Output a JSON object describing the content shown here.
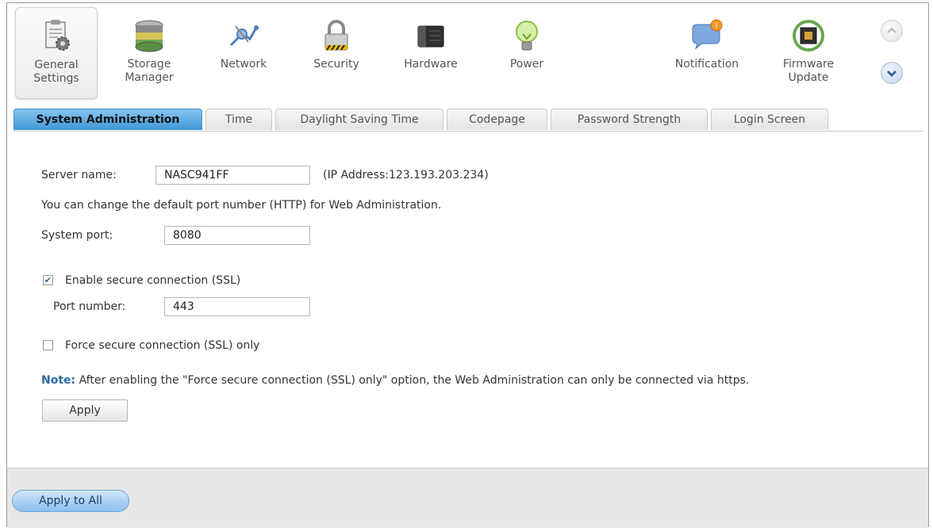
{
  "toolbar": {
    "items": [
      {
        "label": "General\nSettings",
        "icon": "general-settings-icon"
      },
      {
        "label": "Storage\nManager",
        "icon": "storage-manager-icon"
      },
      {
        "label": "Network",
        "icon": "network-icon"
      },
      {
        "label": "Security",
        "icon": "lock-icon"
      },
      {
        "label": "Hardware",
        "icon": "hardware-icon"
      },
      {
        "label": "Power",
        "icon": "power-bulb-icon"
      },
      {
        "label": "Notification",
        "icon": "notification-icon"
      },
      {
        "label": "Firmware\nUpdate",
        "icon": "firmware-chip-icon"
      }
    ],
    "scroll_up_icon": "chevron-up-icon",
    "scroll_down_icon": "chevron-down-icon"
  },
  "tabs": [
    {
      "label": "System Administration"
    },
    {
      "label": "Time"
    },
    {
      "label": "Daylight Saving Time"
    },
    {
      "label": "Codepage"
    },
    {
      "label": "Password Strength"
    },
    {
      "label": "Login Screen"
    }
  ],
  "form": {
    "server_name_label": "Server name:",
    "server_name_value": "NASC941FF",
    "ip_info": "(IP Address:123.193.203.234)",
    "port_info": "You can change the default port number (HTTP) for Web Administration.",
    "system_port_label": "System port:",
    "system_port_value": "8080",
    "ssl_label": "Enable secure connection (SSL)",
    "ssl_checked": true,
    "port_number_label": "Port number:",
    "port_number_value": "443",
    "force_ssl_label": "Force secure connection (SSL) only",
    "force_ssl_checked": false,
    "note_label": "Note:",
    "note_text": " After enabling the \"Force secure connection (SSL) only\" option, the Web Administration can only be connected via https.",
    "apply_label": "Apply"
  },
  "footer": {
    "apply_all_label": "Apply to All"
  },
  "colors": {
    "active_tab": "#3f97d6",
    "note": "#2e6aa8",
    "footer_bg": "#e7e7e7"
  }
}
